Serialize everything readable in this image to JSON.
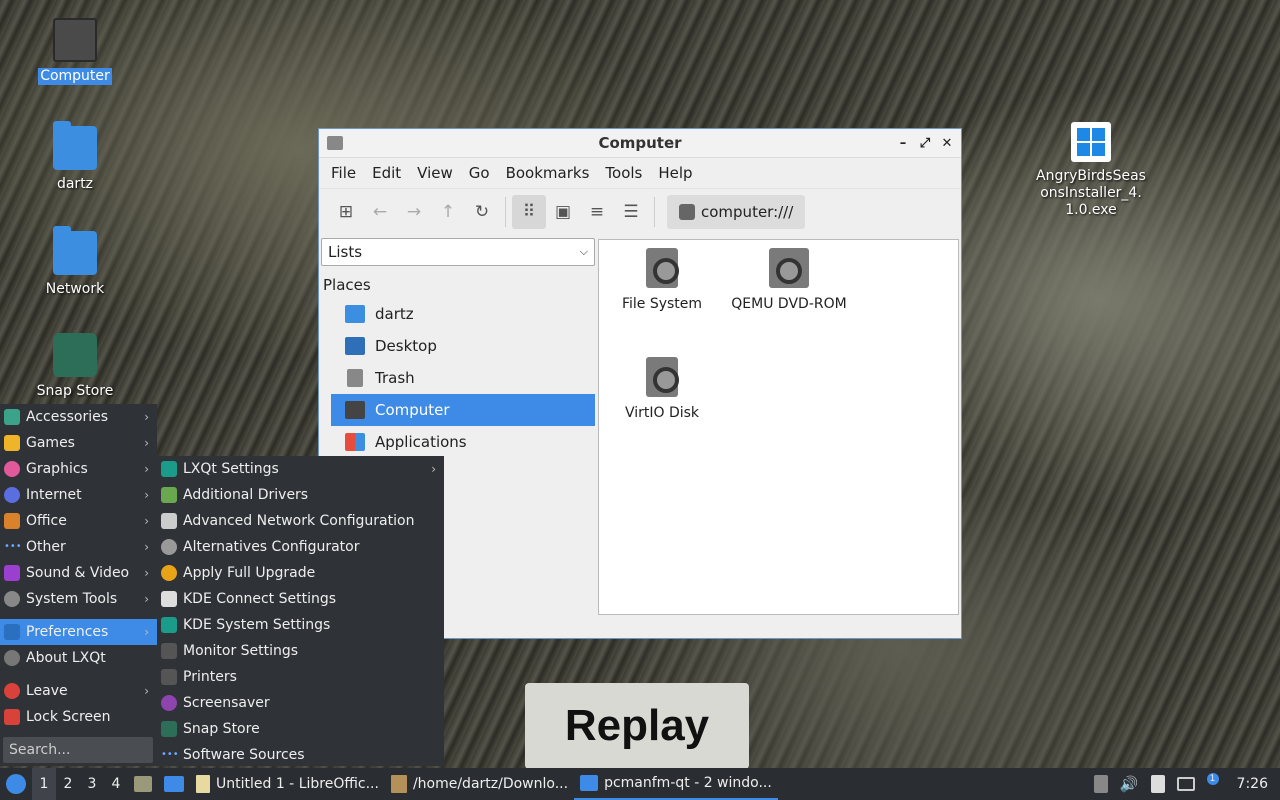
{
  "desktop": {
    "icons": [
      {
        "label": "Computer"
      },
      {
        "label": "dartz"
      },
      {
        "label": "Network"
      },
      {
        "label": "Snap Store"
      },
      {
        "label": "AngryBirdsSeasonsInstaller_4.1.0.exe"
      }
    ],
    "replay_text": "Replay"
  },
  "window": {
    "title": "Computer",
    "controls": {
      "minimize": "–",
      "maximize": "⤢",
      "close": "✕"
    },
    "menu": [
      "File",
      "Edit",
      "View",
      "Go",
      "Bookmarks",
      "Tools",
      "Help"
    ],
    "path": "computer:///",
    "side_view": "Lists",
    "places_label": "Places",
    "places": [
      "dartz",
      "Desktop",
      "Trash",
      "Computer",
      "Applications"
    ],
    "files": [
      "File System",
      "QEMU DVD-ROM",
      "VirtIO Disk"
    ]
  },
  "start_menu": {
    "items": [
      "Accessories",
      "Games",
      "Graphics",
      "Internet",
      "Office",
      "Other",
      "Sound & Video",
      "System Tools",
      "Preferences",
      "About LXQt",
      "Leave",
      "Lock Screen"
    ],
    "search_placeholder": "Search...",
    "submenu": [
      "LXQt Settings",
      "Additional Drivers",
      "Advanced Network Configuration",
      "Alternatives Configurator",
      "Apply Full Upgrade",
      "KDE Connect Settings",
      "KDE System Settings",
      "Monitor Settings",
      "Printers",
      "Screensaver",
      "Snap Store",
      "Software Sources"
    ]
  },
  "taskbar": {
    "workspaces": [
      "1",
      "2",
      "3",
      "4"
    ],
    "tasks": [
      "Untitled 1 - LibreOffic...",
      "/home/dartz/Downlo...",
      "pcmanfm-qt - 2 windo..."
    ],
    "clock": "7:26",
    "notification_badge": "1"
  },
  "colors": {
    "accent": "#3d8be6",
    "menu_bg": "#2f3237",
    "taskbar_bg": "#2a2d31"
  }
}
